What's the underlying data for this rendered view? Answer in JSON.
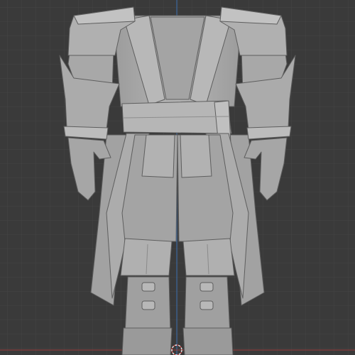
{
  "viewport": {
    "background_color": "#3a3a3a",
    "grid_minor_color": "#404040",
    "grid_major_color": "#2f2f2f",
    "axis_x_color": "#9a3b3b",
    "axis_y_color": "#3a6fb0",
    "model_color": "#a9a9a9",
    "model_highlight": "#bdbdbd",
    "model_shadow": "#8a8a8a",
    "model_outline": "#5e5e5e",
    "origin_cursor_icon": "3d-cursor-icon"
  },
  "model": {
    "semantic_name": "armored-robed-character-body",
    "parts": [
      "shoulder-pads",
      "collar",
      "torso-robe",
      "sash-belt",
      "bracers",
      "hands",
      "coat-tails",
      "pants",
      "knee-guards",
      "boots"
    ]
  }
}
